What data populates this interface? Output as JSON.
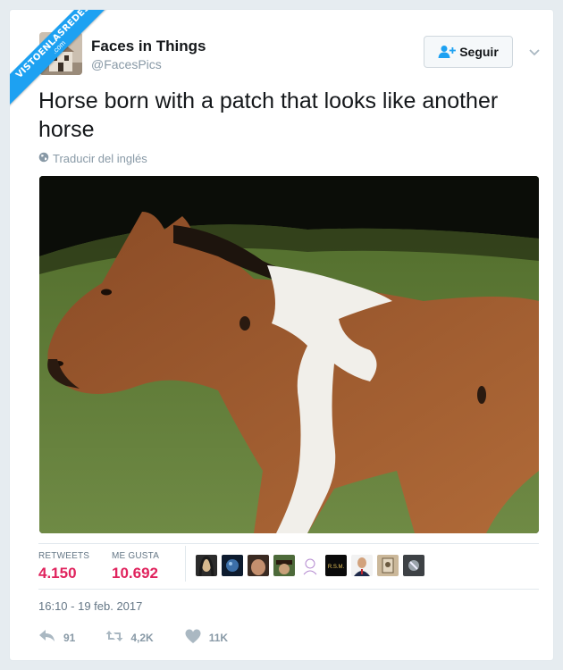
{
  "watermark": {
    "text": "VISTOENLASREDES",
    "subtext": ".com"
  },
  "tweet": {
    "display_name": "Faces in Things",
    "handle": "@FacesPics",
    "follow_label": "Seguir",
    "text": "Horse born with a patch that looks like another horse",
    "translate_label": "Traducir del inglés",
    "image_alt": "Brown and white foal whose white patch is shaped like a horse",
    "stats": {
      "retweets_label": "RETWEETS",
      "retweets_value": "4.150",
      "likes_label": "ME GUSTA",
      "likes_value": "10.692"
    },
    "liker_avatars": [
      "avatar-1",
      "avatar-2",
      "avatar-3",
      "avatar-4",
      "avatar-5",
      "avatar-6",
      "avatar-7",
      "avatar-8",
      "avatar-9"
    ],
    "liker_avatar_6_text": "R.S.M.",
    "timestamp": "16:10 - 19 feb. 2017",
    "actions": {
      "reply_count": "91",
      "retweet_count": "4,2K",
      "like_count": "11K"
    }
  },
  "colors": {
    "accent": "#1da1f2",
    "like": "#e0245e",
    "muted": "#8899a6"
  },
  "icons": [
    "globe-icon",
    "add-person-icon",
    "chevron-down-icon",
    "reply-icon",
    "retweet-icon",
    "heart-icon"
  ]
}
